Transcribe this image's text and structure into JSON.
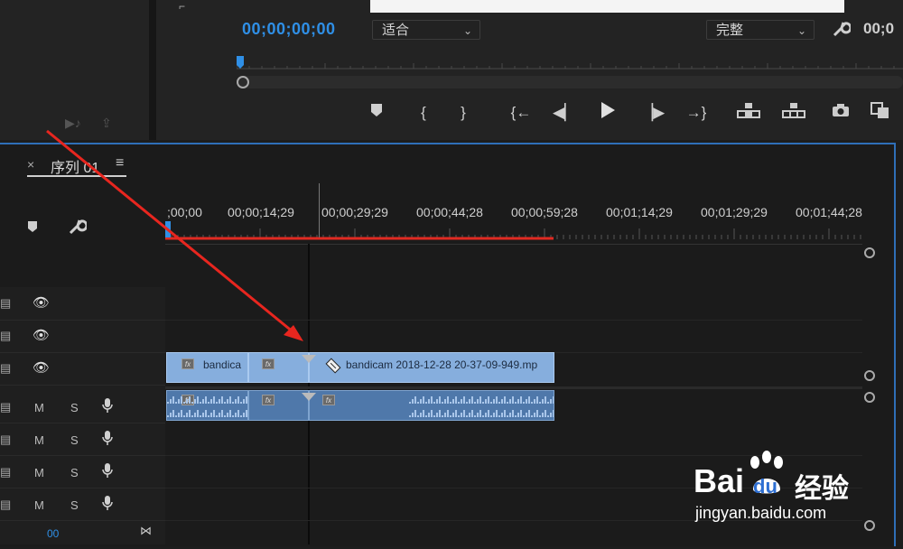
{
  "monitor": {
    "timecode": "00;00;00;00",
    "timecode_right": "00;0",
    "fit_select": "适合",
    "quality_select": "完整",
    "transport": [
      "marker-icon",
      "mark-in-icon",
      "mark-out-icon",
      "go-to-in-icon",
      "step-back-icon",
      "play-icon",
      "step-forward-icon",
      "go-to-out-icon",
      "insert-icon",
      "overwrite-icon",
      "export-frame-icon",
      "compare-icon"
    ]
  },
  "timeline": {
    "close_glyph": "×",
    "sequence_name": "序列 01",
    "menu_glyph": "≡",
    "ruler_labels": [
      ";00;00",
      "00;00;14;29",
      "00;00;29;29",
      "00;00;44;28",
      "00;00;59;28",
      "00;01;14;29",
      "00;01;29;29",
      "00;01;44;28"
    ],
    "mute_label": "M",
    "solo_label": "S",
    "clips": {
      "v1_a": "bandica",
      "v1_b": "bandicam 2018-12-28 20-37-09-949.mp",
      "fx_label": "fx"
    },
    "footer_value": "00"
  },
  "watermark": {
    "logo_text_left": "Bai",
    "logo_text_right": "du",
    "logo_cn": "经验",
    "url": "jingyan.baidu.com"
  },
  "colors": {
    "accent_blue": "#2f8fe6",
    "clip_video": "#86aedd",
    "clip_audio": "#4f78aa",
    "arrow_red": "#e8261f"
  }
}
